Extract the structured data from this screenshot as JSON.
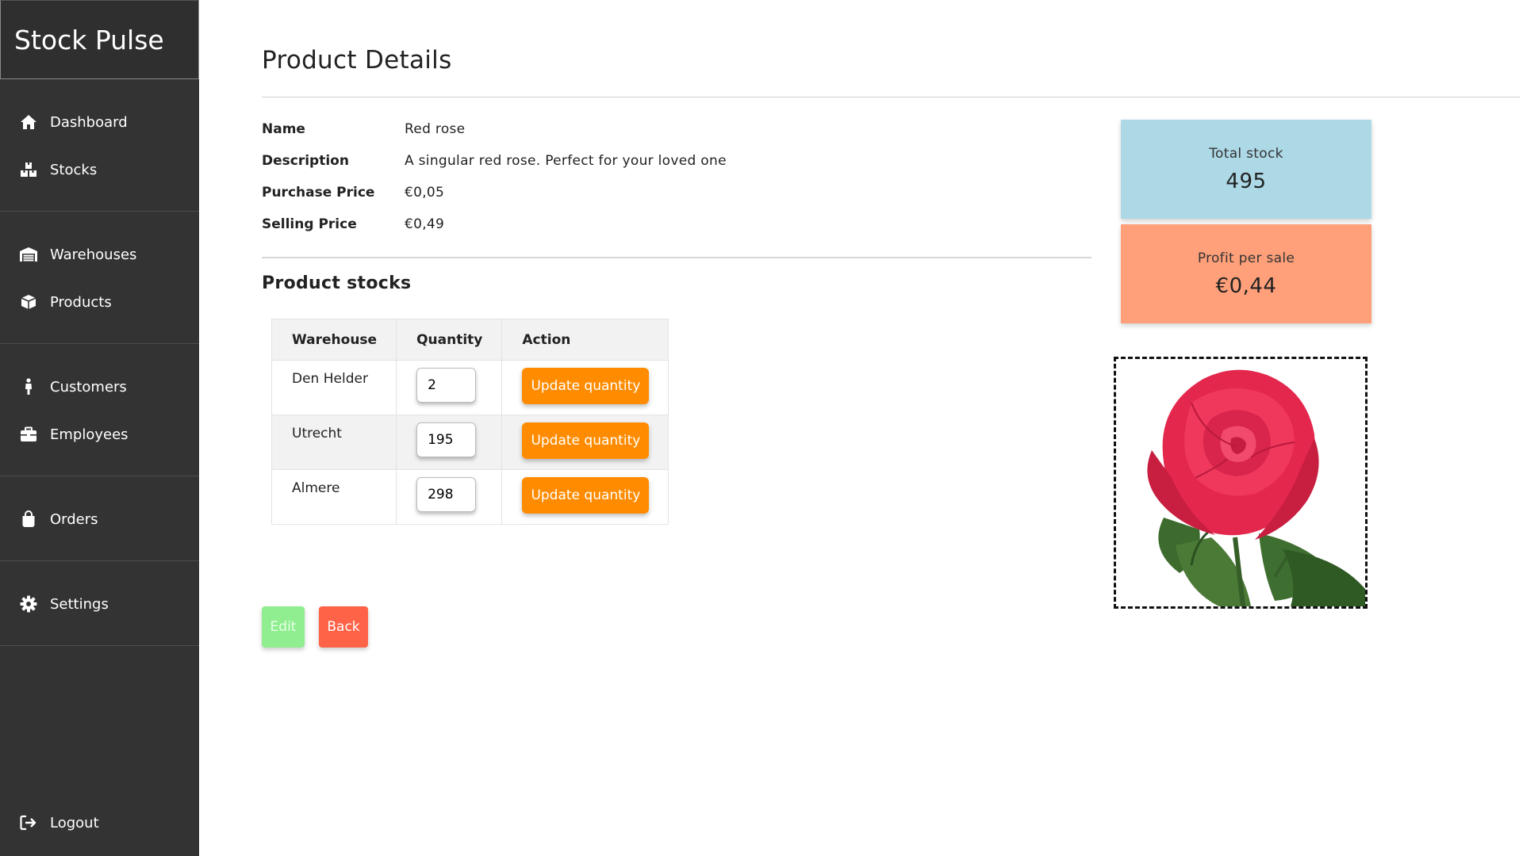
{
  "app": {
    "title": "Stock Pulse"
  },
  "sidebar": {
    "groups": [
      {
        "items": [
          {
            "label": "Dashboard",
            "icon": "home-icon"
          },
          {
            "label": "Stocks",
            "icon": "boxes-icon"
          }
        ]
      },
      {
        "items": [
          {
            "label": "Warehouses",
            "icon": "warehouse-icon"
          },
          {
            "label": "Products",
            "icon": "box-icon"
          }
        ]
      },
      {
        "items": [
          {
            "label": "Customers",
            "icon": "person-icon"
          },
          {
            "label": "Employees",
            "icon": "briefcase-icon"
          }
        ]
      },
      {
        "items": [
          {
            "label": "Orders",
            "icon": "shopping-bag-icon"
          }
        ]
      },
      {
        "items": [
          {
            "label": "Settings",
            "icon": "gear-icon"
          }
        ]
      }
    ],
    "logout": {
      "label": "Logout",
      "icon": "logout-icon"
    }
  },
  "page": {
    "title": "Product Details",
    "details": [
      {
        "label": "Name",
        "value": "Red rose"
      },
      {
        "label": "Description",
        "value": "A singular red rose. Perfect for your loved one"
      },
      {
        "label": "Purchase Price",
        "value": "€0,05"
      },
      {
        "label": "Selling Price",
        "value": "€0,49"
      }
    ],
    "stocks_title": "Product stocks",
    "stocks_table": {
      "headers": [
        "Warehouse",
        "Quantity",
        "Action"
      ],
      "rows": [
        {
          "warehouse": "Den Helder",
          "quantity": "2",
          "action": "Update quantity"
        },
        {
          "warehouse": "Utrecht",
          "quantity": "195",
          "action": "Update quantity"
        },
        {
          "warehouse": "Almere",
          "quantity": "298",
          "action": "Update quantity"
        }
      ]
    },
    "buttons": {
      "edit": "Edit",
      "back": "Back"
    }
  },
  "stats": {
    "total_stock": {
      "label": "Total stock",
      "value": "495"
    },
    "profit_per_sale": {
      "label": "Profit per sale",
      "value": "€0,44"
    }
  },
  "colors": {
    "sidebar_bg": "#333333",
    "total_stock_bg": "#add8e6",
    "profit_bg": "#ffa07a",
    "update_button": "#ff8c00",
    "edit_button": "#90ee90",
    "back_button": "#ff6347"
  }
}
